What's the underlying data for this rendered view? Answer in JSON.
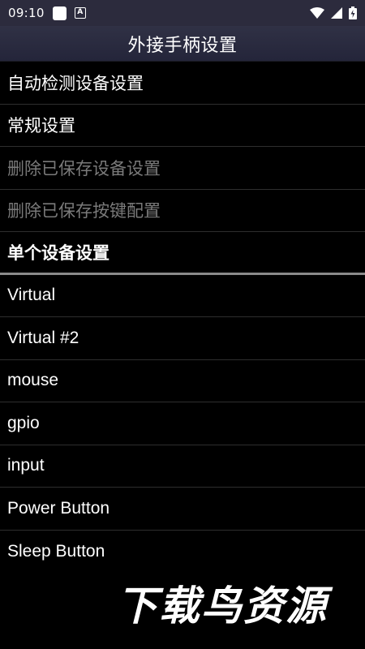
{
  "status_bar": {
    "time": "09:10",
    "notification_icon_label": "A",
    "icons": [
      "notification-square-icon",
      "a-notification-icon",
      "wifi-icon",
      "cell-signal-icon",
      "battery-icon"
    ]
  },
  "app_bar": {
    "title": "外接手柄设置"
  },
  "menu": {
    "items": [
      {
        "label": "自动检测设备设置",
        "enabled": true
      },
      {
        "label": "常规设置",
        "enabled": true
      },
      {
        "label": "删除已保存设备设置",
        "enabled": false
      },
      {
        "label": "删除已保存按键配置",
        "enabled": false
      }
    ],
    "section_header": "单个设备设置"
  },
  "devices": [
    "Virtual",
    "Virtual #2",
    "mouse",
    "gpio",
    "input",
    "Power Button",
    "Sleep Button"
  ],
  "watermark": "下载鸟资源"
}
